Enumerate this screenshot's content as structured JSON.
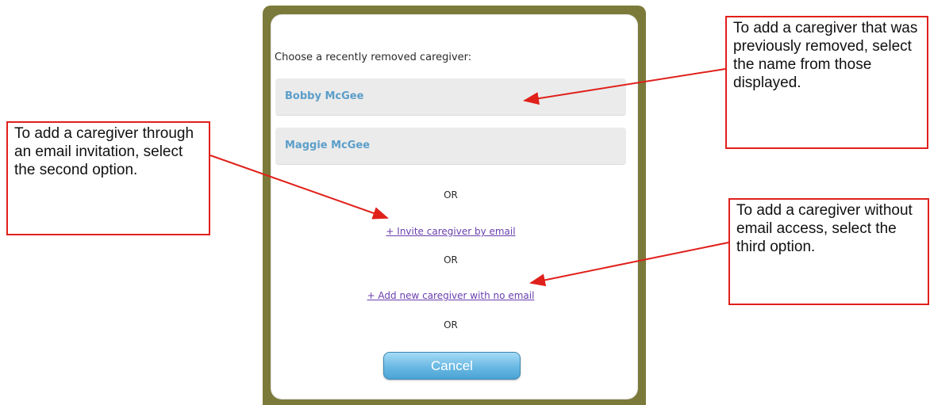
{
  "dialog": {
    "prompt": "Choose a recently removed caregiver:",
    "removed_caregivers": [
      "Bobby McGee",
      "Maggie McGee"
    ],
    "or_text": "OR",
    "invite_link": "+ Invite caregiver by email",
    "no_email_link": "+ Add new caregiver with no email",
    "cancel_label": "Cancel"
  },
  "callouts": {
    "email_invitation": "To add a caregiver through an email invitation, select the second option.",
    "previously_removed": "To add a caregiver that was previously removed, select the name from those displayed.",
    "no_email": "To add a caregiver without email access, select the third option."
  },
  "colors": {
    "callout_border": "#e0201b",
    "arrow": "#e0201b",
    "name_text": "#5b9ec9",
    "link_text": "#6a3fae",
    "frame": "#7b7a3a",
    "button": "#69b8e3"
  }
}
